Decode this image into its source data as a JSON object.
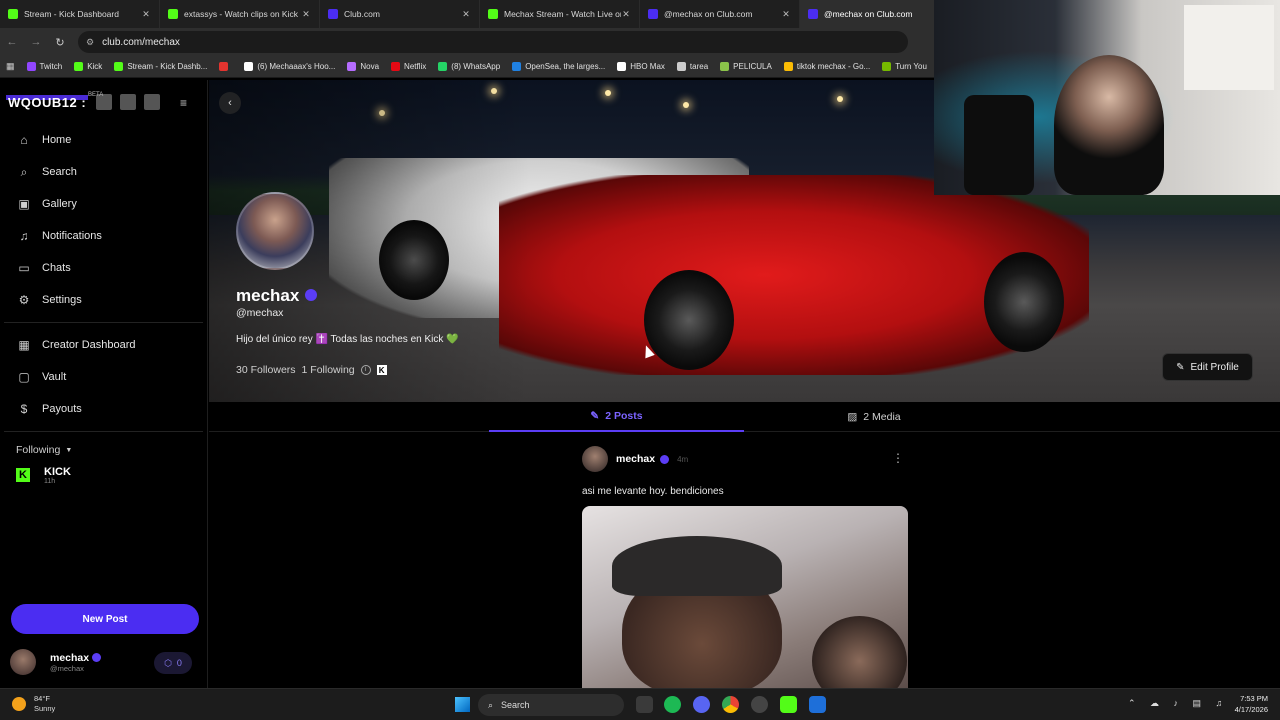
{
  "browser": {
    "tabs": [
      {
        "title": "Stream - Kick Dashboard",
        "favicon_color": "#53fc18",
        "active": false
      },
      {
        "title": "extassys - Watch clips on Kick",
        "favicon_color": "#53fc18",
        "active": false
      },
      {
        "title": "Club.com",
        "favicon_color": "#4b2df2",
        "active": false
      },
      {
        "title": "Mechax Stream - Watch Live on",
        "favicon_color": "#53fc18",
        "active": false
      },
      {
        "title": "@mechax on Club.com",
        "favicon_color": "#4b2df2",
        "active": false
      },
      {
        "title": "@mechax on Club.com",
        "favicon_color": "#4b2df2",
        "active": true
      }
    ],
    "url": "club.com/mechax",
    "bookmarks": [
      {
        "label": "Twitch",
        "color": "#9146ff"
      },
      {
        "label": "Kick",
        "color": "#53fc18"
      },
      {
        "label": "Stream - Kick Dashb...",
        "color": "#53fc18"
      },
      {
        "label": "",
        "color": "#e3342f"
      },
      {
        "label": "(6) Mechaaax's Hoo...",
        "color": "#ffffff"
      },
      {
        "label": "Nova",
        "color": "#b56cff"
      },
      {
        "label": "Netflix",
        "color": "#e50914"
      },
      {
        "label": "(8) WhatsApp",
        "color": "#25d366"
      },
      {
        "label": "OpenSea, the larges...",
        "color": "#2081e2"
      },
      {
        "label": "HBO Max",
        "color": "#ffffff"
      },
      {
        "label": "tarea",
        "color": "#cccccc"
      },
      {
        "label": "PELICULA",
        "color": "#8bc34a"
      },
      {
        "label": "tiktok mechax - Go...",
        "color": "#fbbc04"
      },
      {
        "label": "Turn You",
        "color": "#76b900"
      }
    ]
  },
  "sidebar": {
    "logo": "WQOUB12 :",
    "beta": "BETA",
    "nav": [
      {
        "label": "Home",
        "icon": "home-icon",
        "glyph": "⌂"
      },
      {
        "label": "Search",
        "icon": "search-icon",
        "glyph": "⌕"
      },
      {
        "label": "Gallery",
        "icon": "gallery-icon",
        "glyph": "▣"
      },
      {
        "label": "Notifications",
        "icon": "bell-icon",
        "glyph": "♫"
      },
      {
        "label": "Chats",
        "icon": "chat-icon",
        "glyph": "▭"
      },
      {
        "label": "Settings",
        "icon": "gear-icon",
        "glyph": "⚙"
      }
    ],
    "creator_nav": [
      {
        "label": "Creator Dashboard",
        "icon": "dashboard-icon",
        "glyph": "▦"
      },
      {
        "label": "Vault",
        "icon": "vault-icon",
        "glyph": "▢"
      },
      {
        "label": "Payouts",
        "icon": "dollar-icon",
        "glyph": "$"
      }
    ],
    "following_label": "Following",
    "following_items": [
      {
        "name": "KICK",
        "time": "11h"
      }
    ],
    "new_post_label": "New Post",
    "me": {
      "name": "mechax",
      "handle": "@mechax",
      "coins": "0"
    }
  },
  "profile": {
    "name": "mechax",
    "handle": "@mechax",
    "bio": "Hijo del único rey ✝️ Todas las noches en Kick 💚",
    "followers": "30 Followers",
    "following": "1 Following",
    "edit_label": "Edit Profile",
    "tabs": {
      "posts": "2 Posts",
      "media": "2 Media"
    }
  },
  "post": {
    "author": "mechax",
    "time": "4m",
    "text": "asi me levante hoy. bendiciones"
  },
  "taskbar": {
    "temp": "84°F",
    "condition": "Sunny",
    "search_label": "Search",
    "time": "7:53 PM",
    "date": "4/17/2026"
  }
}
